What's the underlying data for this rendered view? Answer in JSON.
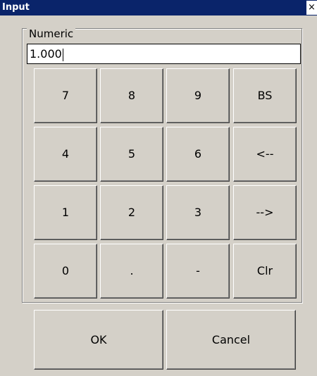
{
  "window": {
    "title": "Input",
    "close_glyph": "×"
  },
  "group": {
    "label": "Numeric"
  },
  "input": {
    "value": "1.000"
  },
  "keypad": {
    "row1": [
      "7",
      "8",
      "9",
      "BS"
    ],
    "row2": [
      "4",
      "5",
      "6",
      "<--"
    ],
    "row3": [
      "1",
      "2",
      "3",
      "-->"
    ],
    "row4": [
      "0",
      ".",
      "-",
      "Clr"
    ]
  },
  "footer": {
    "ok_label": "OK",
    "cancel_label": "Cancel"
  }
}
